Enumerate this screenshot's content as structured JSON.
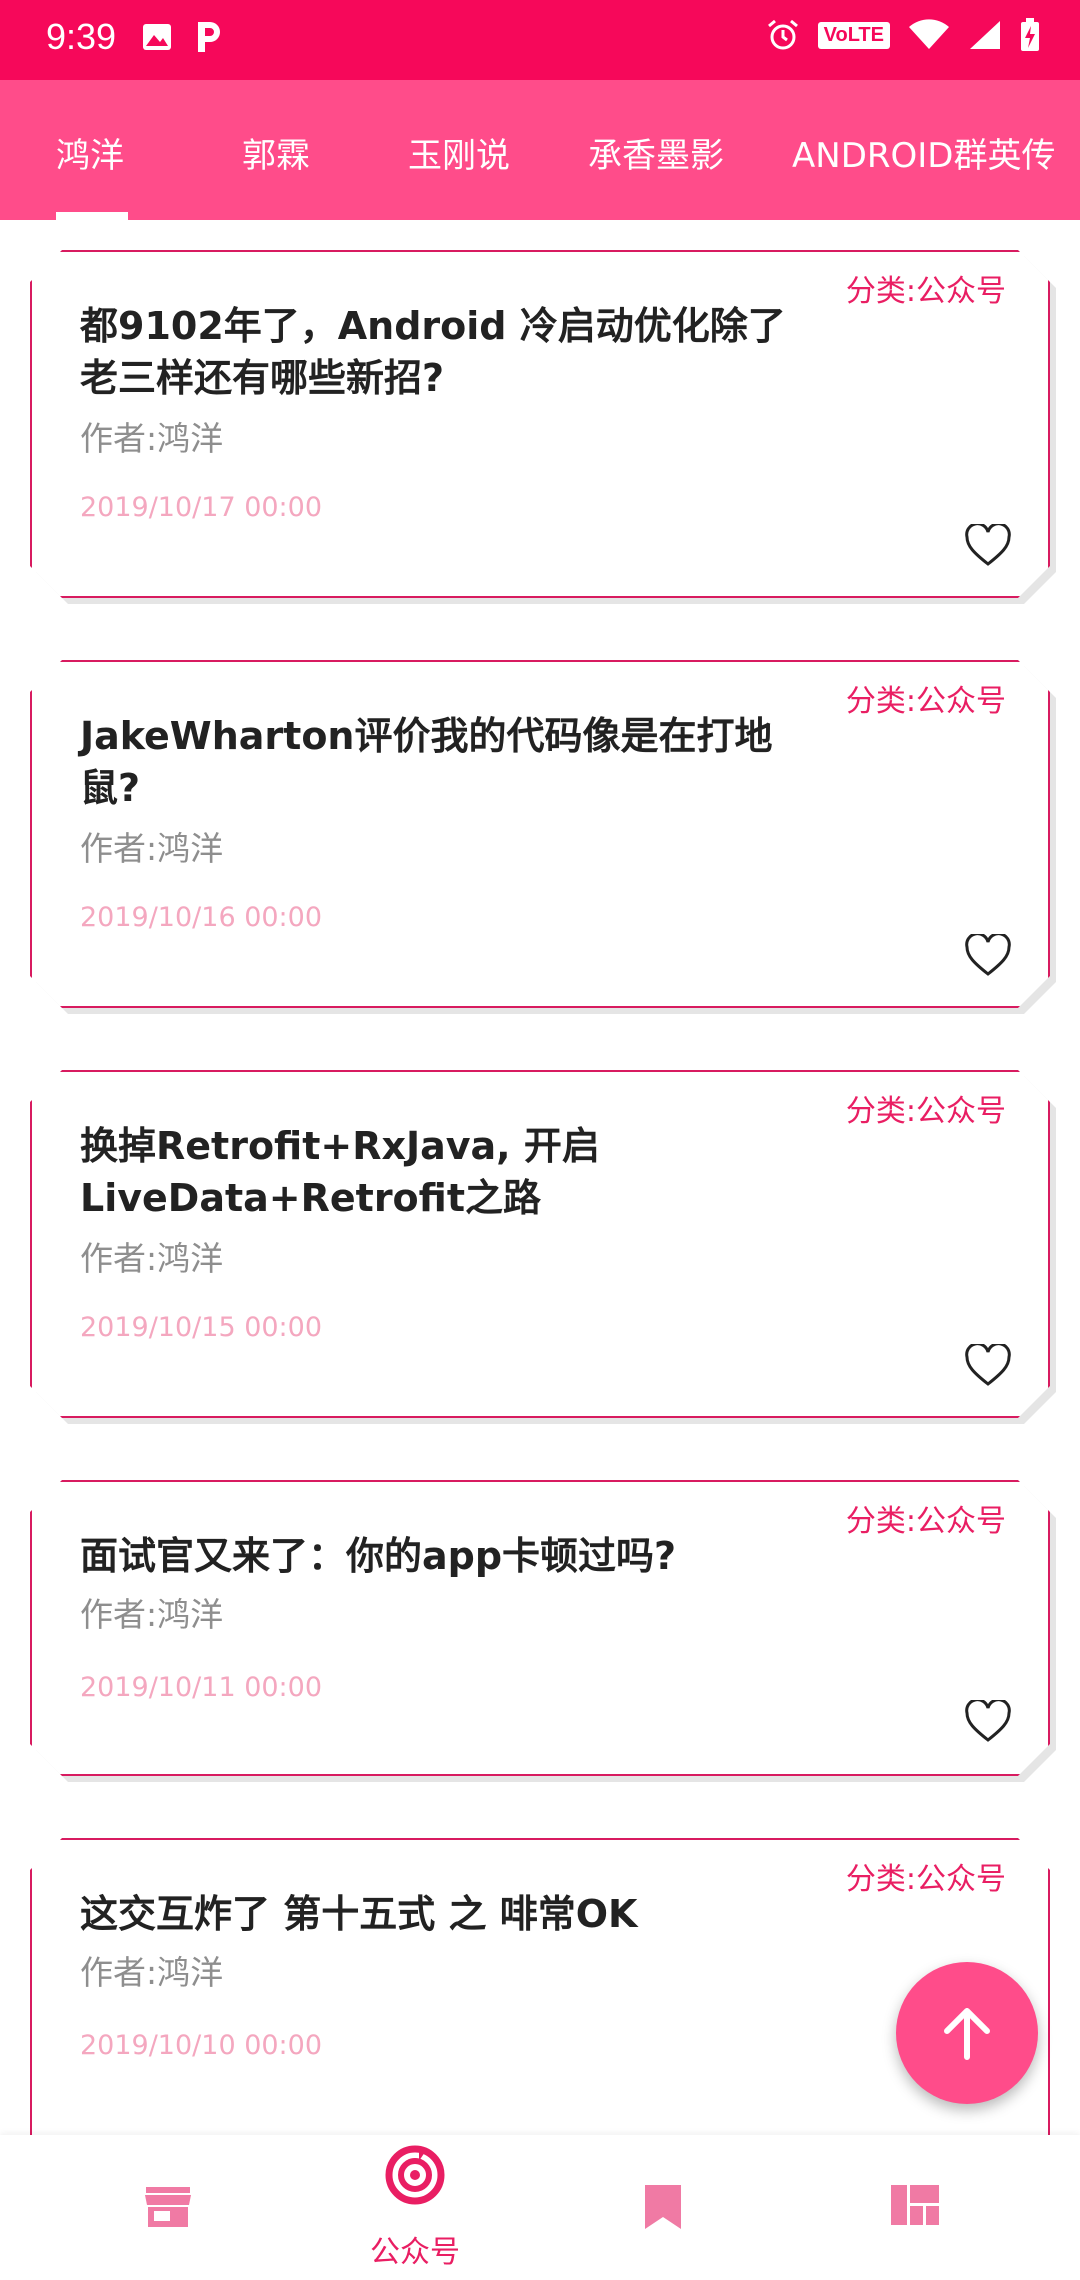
{
  "status_bar": {
    "time": "9:39",
    "volte": "VoLTE",
    "icons": [
      "image-icon",
      "p-app-icon",
      "alarm-icon",
      "wifi-icon",
      "signal-icon",
      "battery-charging-icon"
    ]
  },
  "tabs": [
    {
      "label": "鸿洋",
      "selected": true
    },
    {
      "label": "郭霖",
      "selected": false
    },
    {
      "label": "玉刚说",
      "selected": false
    },
    {
      "label": "承香墨影",
      "selected": false
    },
    {
      "label": "ANDROID群英传",
      "selected": false
    }
  ],
  "articles": [
    {
      "category": "分类:公众号",
      "title": "都9102年了，Android 冷启动优化除了老三样还有哪些新招?",
      "author": "作者:鸿洋",
      "date": "2019/10/17 00:00"
    },
    {
      "category": "分类:公众号",
      "title": "JakeWharton评价我的代码像是在打地鼠?",
      "author": "作者:鸿洋",
      "date": "2019/10/16 00:00"
    },
    {
      "category": "分类:公众号",
      "title": "换掉Retrofit+RxJava, 开启LiveData+Retrofit之路",
      "author": "作者:鸿洋",
      "date": "2019/10/15 00:00"
    },
    {
      "category": "分类:公众号",
      "title": "面试官又来了：你的app卡顿过吗?",
      "author": "作者:鸿洋",
      "date": "2019/10/11 00:00"
    },
    {
      "category": "分类:公众号",
      "title": "这交互炸了 第十五式 之 啡常OK",
      "author": "作者:鸿洋",
      "date": "2019/10/10 00:00"
    }
  ],
  "bottom_nav": [
    {
      "icon": "store-icon",
      "label": ""
    },
    {
      "icon": "target-icon",
      "label": "公众号",
      "selected": true
    },
    {
      "icon": "bookmark-icon",
      "label": ""
    },
    {
      "icon": "dashboard-icon",
      "label": ""
    }
  ],
  "colors": {
    "primary": "#ff4c8a",
    "status_bar": "#f6085a",
    "accent": "#e91e63"
  }
}
